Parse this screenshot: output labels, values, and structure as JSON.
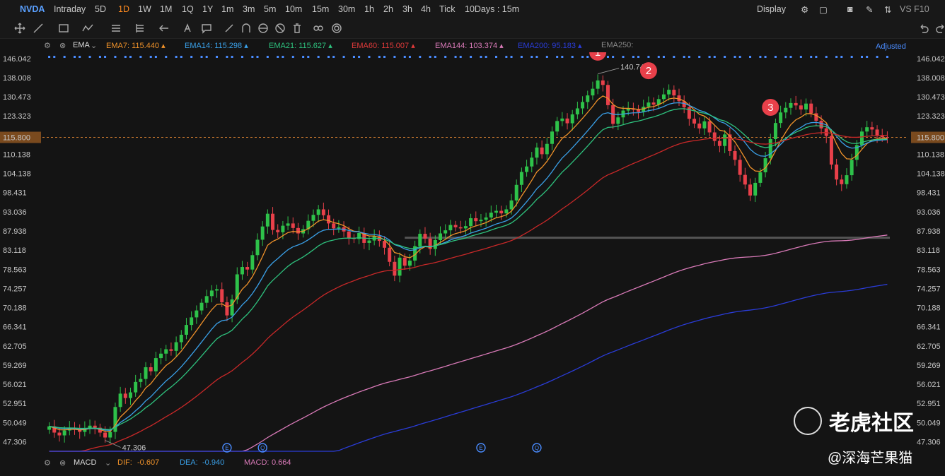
{
  "header": {
    "symbol": "NVDA",
    "timeframes": [
      "Intraday",
      "5D",
      "1D",
      "1W",
      "1M",
      "1Q",
      "1Y",
      "1m",
      "3m",
      "5m",
      "10m",
      "15m",
      "30m",
      "1h",
      "2h",
      "3h",
      "4h",
      "Tick"
    ],
    "active_timeframe": "1D",
    "range_label": "10Days : 15m",
    "display_label": "Display",
    "vs_label": "VS F10"
  },
  "indicator_bar": {
    "name": "EMA",
    "items": [
      {
        "label": "EMA7:",
        "value": "115.440",
        "color": "#f0922a"
      },
      {
        "label": "EMA14:",
        "value": "115.298",
        "color": "#3aa0e8"
      },
      {
        "label": "EMA21:",
        "value": "115.627",
        "color": "#2ec27e"
      },
      {
        "label": "EMA60:",
        "value": "115.007",
        "color": "#e03a3a"
      },
      {
        "label": "EMA144:",
        "value": "103.374",
        "color": "#d97ab8"
      },
      {
        "label": "EMA200:",
        "value": "95.183",
        "color": "#2a3cd8"
      },
      {
        "label": "EMA250:",
        "value": "",
        "color": "#888888"
      }
    ],
    "adjusted_label": "Adjusted"
  },
  "macd_bar": {
    "name": "MACD",
    "dif_label": "DIF:",
    "dif": "-0.607",
    "dea_label": "DEA:",
    "dea": "-0.940",
    "macd_label": "MACD:",
    "macd": "0.664"
  },
  "annotations": {
    "high_label": "140.747",
    "low_label": "47.306",
    "markers": [
      "1",
      "2",
      "3"
    ],
    "event_icons": [
      "E",
      "Q",
      "E",
      "Q"
    ]
  },
  "watermark": {
    "brand": "老虎社区",
    "author": "@深海芒果猫"
  },
  "chart_data": {
    "type": "candlestick",
    "yaxis_ticks": [
      "146.042",
      "138.008",
      "130.473",
      "123.323",
      "115.800",
      "110.138",
      "104.138",
      "98.431",
      "93.036",
      "87.938",
      "83.118",
      "78.563",
      "74.257",
      "70.188",
      "66.341",
      "62.705",
      "59.269",
      "56.021",
      "52.951",
      "50.049",
      "47.306"
    ],
    "last_price": "115.800",
    "ylim": [
      46.0,
      147.5
    ],
    "log_scale": true,
    "closes": [
      49.5,
      48.6,
      48.2,
      48.9,
      49.3,
      49.1,
      48.7,
      49.2,
      49.6,
      49.3,
      48.6,
      47.9,
      48.7,
      52.4,
      54.5,
      53.8,
      54.7,
      56.4,
      56.9,
      58.9,
      58.2,
      60.5,
      61.3,
      62.1,
      61.8,
      63.4,
      64.8,
      66.7,
      68.2,
      69.6,
      71.2,
      72.6,
      73.8,
      74.1,
      71.3,
      68.6,
      71.9,
      77.4,
      79.1,
      78.5,
      81.9,
      85.7,
      89.1,
      92.5,
      88.2,
      87.6,
      89.3,
      89.9,
      88.7,
      87.3,
      88.4,
      90.6,
      92.2,
      93.7,
      92.1,
      89.9,
      88.6,
      88.9,
      87.8,
      86.1,
      85.9,
      87.4,
      84.9,
      85.5,
      86.6,
      85.4,
      83.7,
      80.3,
      77.1,
      81.3,
      79.4,
      80.6,
      84.1,
      87.2,
      86.0,
      83.4,
      85.6,
      87.3,
      88.1,
      89.5,
      88.9,
      88.6,
      89.2,
      91.3,
      90.5,
      90.9,
      91.5,
      92.8,
      93.3,
      92.6,
      93.7,
      96.2,
      100.7,
      104.6,
      106.3,
      109.1,
      112.4,
      110.2,
      113.6,
      117.8,
      121.5,
      122.4,
      120.7,
      123.9,
      126.1,
      128.5,
      131.0,
      133.6,
      136.9,
      135.1,
      127.3,
      120.5,
      122.8,
      125.3,
      126.1,
      125.6,
      124.8,
      126.7,
      128.3,
      127.5,
      129.6,
      131.4,
      133.2,
      131.0,
      128.8,
      126.5,
      122.3,
      120.6,
      118.9,
      121.4,
      117.5,
      114.6,
      112.9,
      116.8,
      111.2,
      108.4,
      103.7,
      100.8,
      97.6,
      101.3,
      104.5,
      108.9,
      115.2,
      120.8,
      124.6,
      126.3,
      128.1,
      127.2,
      125.7,
      127.9,
      124.3,
      121.6,
      118.9,
      116.3,
      106.9,
      102.3,
      100.9,
      103.6,
      108.4,
      113.2,
      117.8,
      119.3,
      118.5,
      116.4,
      115.9,
      115.8
    ],
    "series": [
      {
        "name": "EMA7",
        "color": "#f0922a"
      },
      {
        "name": "EMA14",
        "color": "#3aa0e8"
      },
      {
        "name": "EMA21",
        "color": "#2ec27e"
      },
      {
        "name": "EMA60",
        "color": "#c82828"
      },
      {
        "name": "EMA144",
        "color": "#d97ab8"
      },
      {
        "name": "EMA200",
        "color": "#2a3cd8"
      }
    ],
    "support_level": 86.2,
    "up_color": "#2ec24a",
    "down_color": "#e8404a"
  }
}
